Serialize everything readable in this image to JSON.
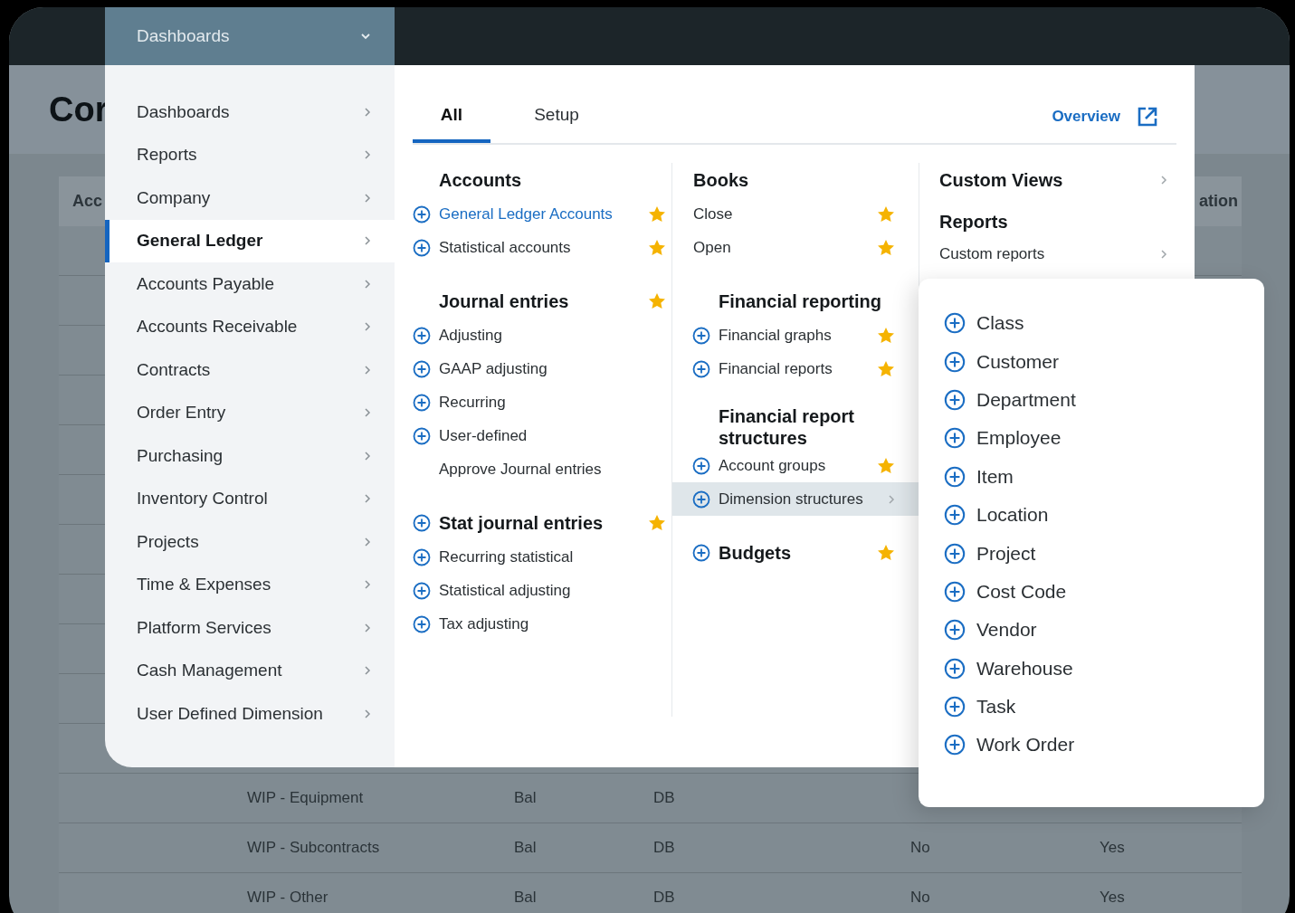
{
  "background_page": {
    "title": "Cor",
    "table": {
      "columns": [
        {
          "label": "Acc"
        },
        {
          "label": "ation"
        }
      ],
      "rows": [
        {
          "cells": [
            "WIP - Equipment",
            "Bal",
            "DB"
          ]
        },
        {
          "cells": [
            "WIP - Subcontracts",
            "Bal",
            "DB",
            "No",
            "Yes"
          ]
        },
        {
          "cells": [
            "WIP - Other",
            "Bal",
            "DB",
            "No",
            "Yes"
          ]
        }
      ]
    }
  },
  "menu": {
    "dropdown": {
      "label": "Dashboards"
    },
    "sidebar": {
      "items": [
        {
          "label": "Dashboards",
          "selected": false
        },
        {
          "label": "Reports",
          "selected": false
        },
        {
          "label": "Company",
          "selected": false
        },
        {
          "label": "General Ledger",
          "selected": true
        },
        {
          "label": "Accounts Payable",
          "selected": false
        },
        {
          "label": "Accounts Receivable",
          "selected": false
        },
        {
          "label": "Contracts",
          "selected": false
        },
        {
          "label": "Order Entry",
          "selected": false
        },
        {
          "label": "Purchasing",
          "selected": false
        },
        {
          "label": "Inventory Control",
          "selected": false
        },
        {
          "label": "Projects",
          "selected": false
        },
        {
          "label": "Time & Expenses",
          "selected": false
        },
        {
          "label": "Platform Services",
          "selected": false
        },
        {
          "label": "Cash Management",
          "selected": false
        },
        {
          "label": "User Defined Dimension",
          "selected": false
        }
      ]
    },
    "tabs": [
      {
        "label": "All",
        "selected": true
      },
      {
        "label": "Setup",
        "selected": false
      }
    ],
    "overview_link": {
      "label": "Overview"
    },
    "columns": [
      {
        "sections": [
          {
            "heading": {
              "label": "Accounts",
              "add_icon": false,
              "starred": false,
              "submenu": false
            },
            "items": [
              {
                "label": "General Ledger Accounts",
                "add_icon": true,
                "starred": true,
                "link": true,
                "highlighted": false,
                "submenu": false
              },
              {
                "label": "Statistical accounts",
                "add_icon": true,
                "starred": true,
                "link": false,
                "highlighted": false,
                "submenu": false
              }
            ]
          },
          {
            "heading": {
              "label": "Journal entries",
              "add_icon": false,
              "starred": true,
              "submenu": false
            },
            "items": [
              {
                "label": "Adjusting",
                "add_icon": true,
                "starred": false,
                "link": false,
                "highlighted": false,
                "submenu": false
              },
              {
                "label": "GAAP adjusting",
                "add_icon": true,
                "starred": false,
                "link": false,
                "highlighted": false,
                "submenu": false
              },
              {
                "label": "Recurring",
                "add_icon": true,
                "starred": false,
                "link": false,
                "highlighted": false,
                "submenu": false
              },
              {
                "label": "User-defined",
                "add_icon": true,
                "starred": false,
                "link": false,
                "highlighted": false,
                "submenu": false
              },
              {
                "label": "Approve Journal entries",
                "add_icon": false,
                "starred": false,
                "link": false,
                "highlighted": false,
                "submenu": false
              }
            ]
          },
          {
            "heading": {
              "label": "Stat journal entries",
              "add_icon": true,
              "starred": true,
              "submenu": false
            },
            "items": [
              {
                "label": "Recurring statistical",
                "add_icon": true,
                "starred": false,
                "link": false,
                "highlighted": false,
                "submenu": false
              },
              {
                "label": "Statistical adjusting",
                "add_icon": true,
                "starred": false,
                "link": false,
                "highlighted": false,
                "submenu": false
              },
              {
                "label": "Tax adjusting",
                "add_icon": true,
                "starred": false,
                "link": false,
                "highlighted": false,
                "submenu": false
              }
            ]
          }
        ]
      },
      {
        "sections": [
          {
            "heading": {
              "label": "Books",
              "add_icon": false,
              "starred": false,
              "submenu": false
            },
            "items": [
              {
                "label": "Close",
                "add_icon": false,
                "starred": true,
                "link": false,
                "highlighted": false,
                "submenu": false
              },
              {
                "label": "Open",
                "add_icon": false,
                "starred": true,
                "link": false,
                "highlighted": false,
                "submenu": false
              }
            ]
          },
          {
            "heading": {
              "label": "Financial reporting",
              "add_icon": false,
              "starred": false,
              "submenu": false
            },
            "items": [
              {
                "label": "Financial graphs",
                "add_icon": true,
                "starred": true,
                "link": false,
                "highlighted": false,
                "submenu": false
              },
              {
                "label": "Financial reports",
                "add_icon": true,
                "starred": true,
                "link": false,
                "highlighted": false,
                "submenu": false
              }
            ]
          },
          {
            "heading": {
              "label": "Financial report structures",
              "add_icon": false,
              "starred": false,
              "submenu": false
            },
            "items": [
              {
                "label": "Account groups",
                "add_icon": true,
                "starred": true,
                "link": false,
                "highlighted": false,
                "submenu": false
              },
              {
                "label": "Dimension structures",
                "add_icon": true,
                "starred": false,
                "link": false,
                "highlighted": true,
                "submenu": true
              }
            ]
          },
          {
            "heading": {
              "label": "Budgets",
              "add_icon": true,
              "starred": true,
              "submenu": false
            }
          }
        ]
      },
      {
        "sections": [
          {
            "heading": {
              "label": "Custom Views",
              "add_icon": false,
              "starred": false,
              "submenu": true
            }
          },
          {
            "heading": {
              "label": "Reports",
              "add_icon": false,
              "starred": false,
              "submenu": false
            },
            "items": [
              {
                "label": "Custom reports",
                "add_icon": false,
                "starred": false,
                "link": false,
                "highlighted": false,
                "submenu": true
              }
            ]
          }
        ]
      }
    ],
    "flyout": {
      "items": [
        {
          "label": "Class"
        },
        {
          "label": "Customer"
        },
        {
          "label": "Department"
        },
        {
          "label": "Employee"
        },
        {
          "label": "Item"
        },
        {
          "label": "Location"
        },
        {
          "label": "Project"
        },
        {
          "label": "Cost Code"
        },
        {
          "label": "Vendor"
        },
        {
          "label": "Warehouse"
        },
        {
          "label": "Task"
        },
        {
          "label": "Work Order"
        }
      ]
    }
  }
}
